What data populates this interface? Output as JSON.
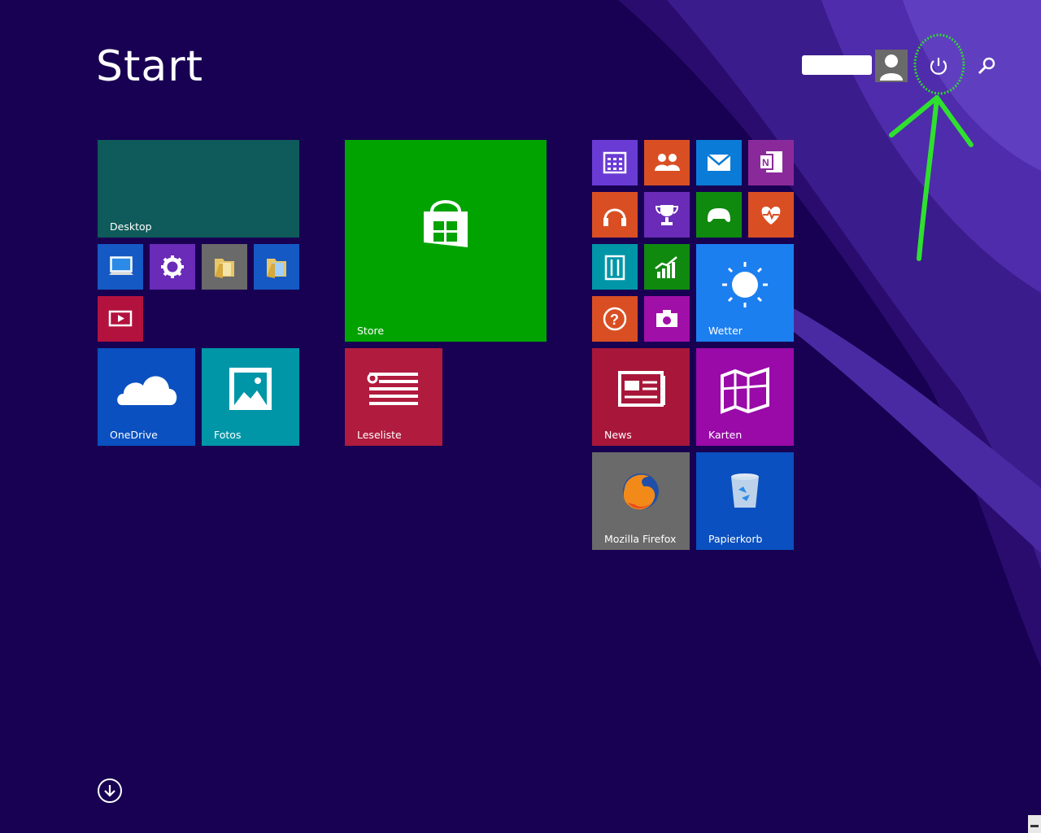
{
  "screen": {
    "title": "Start"
  },
  "header": {
    "user_icon": "user-avatar-icon",
    "power_icon": "power-icon",
    "search_icon": "search-icon"
  },
  "tiles": {
    "desktop": {
      "label": "Desktop",
      "color": "#0f5a5a"
    },
    "store": {
      "label": "Store",
      "color": "#00a300"
    },
    "onedrive": {
      "label": "OneDrive",
      "color": "#0a50c0"
    },
    "fotos": {
      "label": "Fotos",
      "color": "#0096a8"
    },
    "leseliste": {
      "label": "Leseliste",
      "color": "#b01b3e"
    },
    "wetter": {
      "label": "Wetter",
      "color": "#1c7ff0"
    },
    "news": {
      "label": "News",
      "color": "#a8173a"
    },
    "karten": {
      "label": "Karten",
      "color": "#9a0aa8"
    },
    "firefox": {
      "label": "Mozilla Firefox",
      "color": "#6a6a6a"
    },
    "papierkorb": {
      "label": "Papierkorb",
      "color": "#0a50c0"
    }
  },
  "footer": {
    "all_apps_icon": "arrow-down-circle-icon"
  }
}
